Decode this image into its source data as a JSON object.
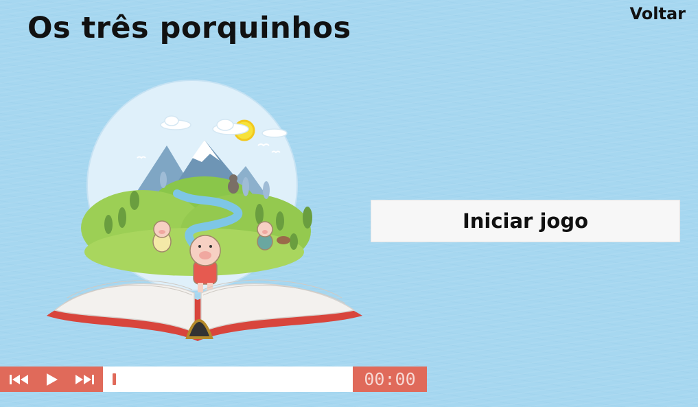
{
  "page": {
    "title": "Os três porquinhos",
    "back_label": "Voltar",
    "start_label": "Iniciar jogo"
  },
  "player": {
    "time": "00:00",
    "progress": 0,
    "controls": [
      "rewind-icon",
      "play-icon",
      "fast-forward-icon"
    ]
  },
  "colors": {
    "background": "#a6d7f0",
    "accent": "#e06a5a",
    "button": "#f7f7f7"
  }
}
